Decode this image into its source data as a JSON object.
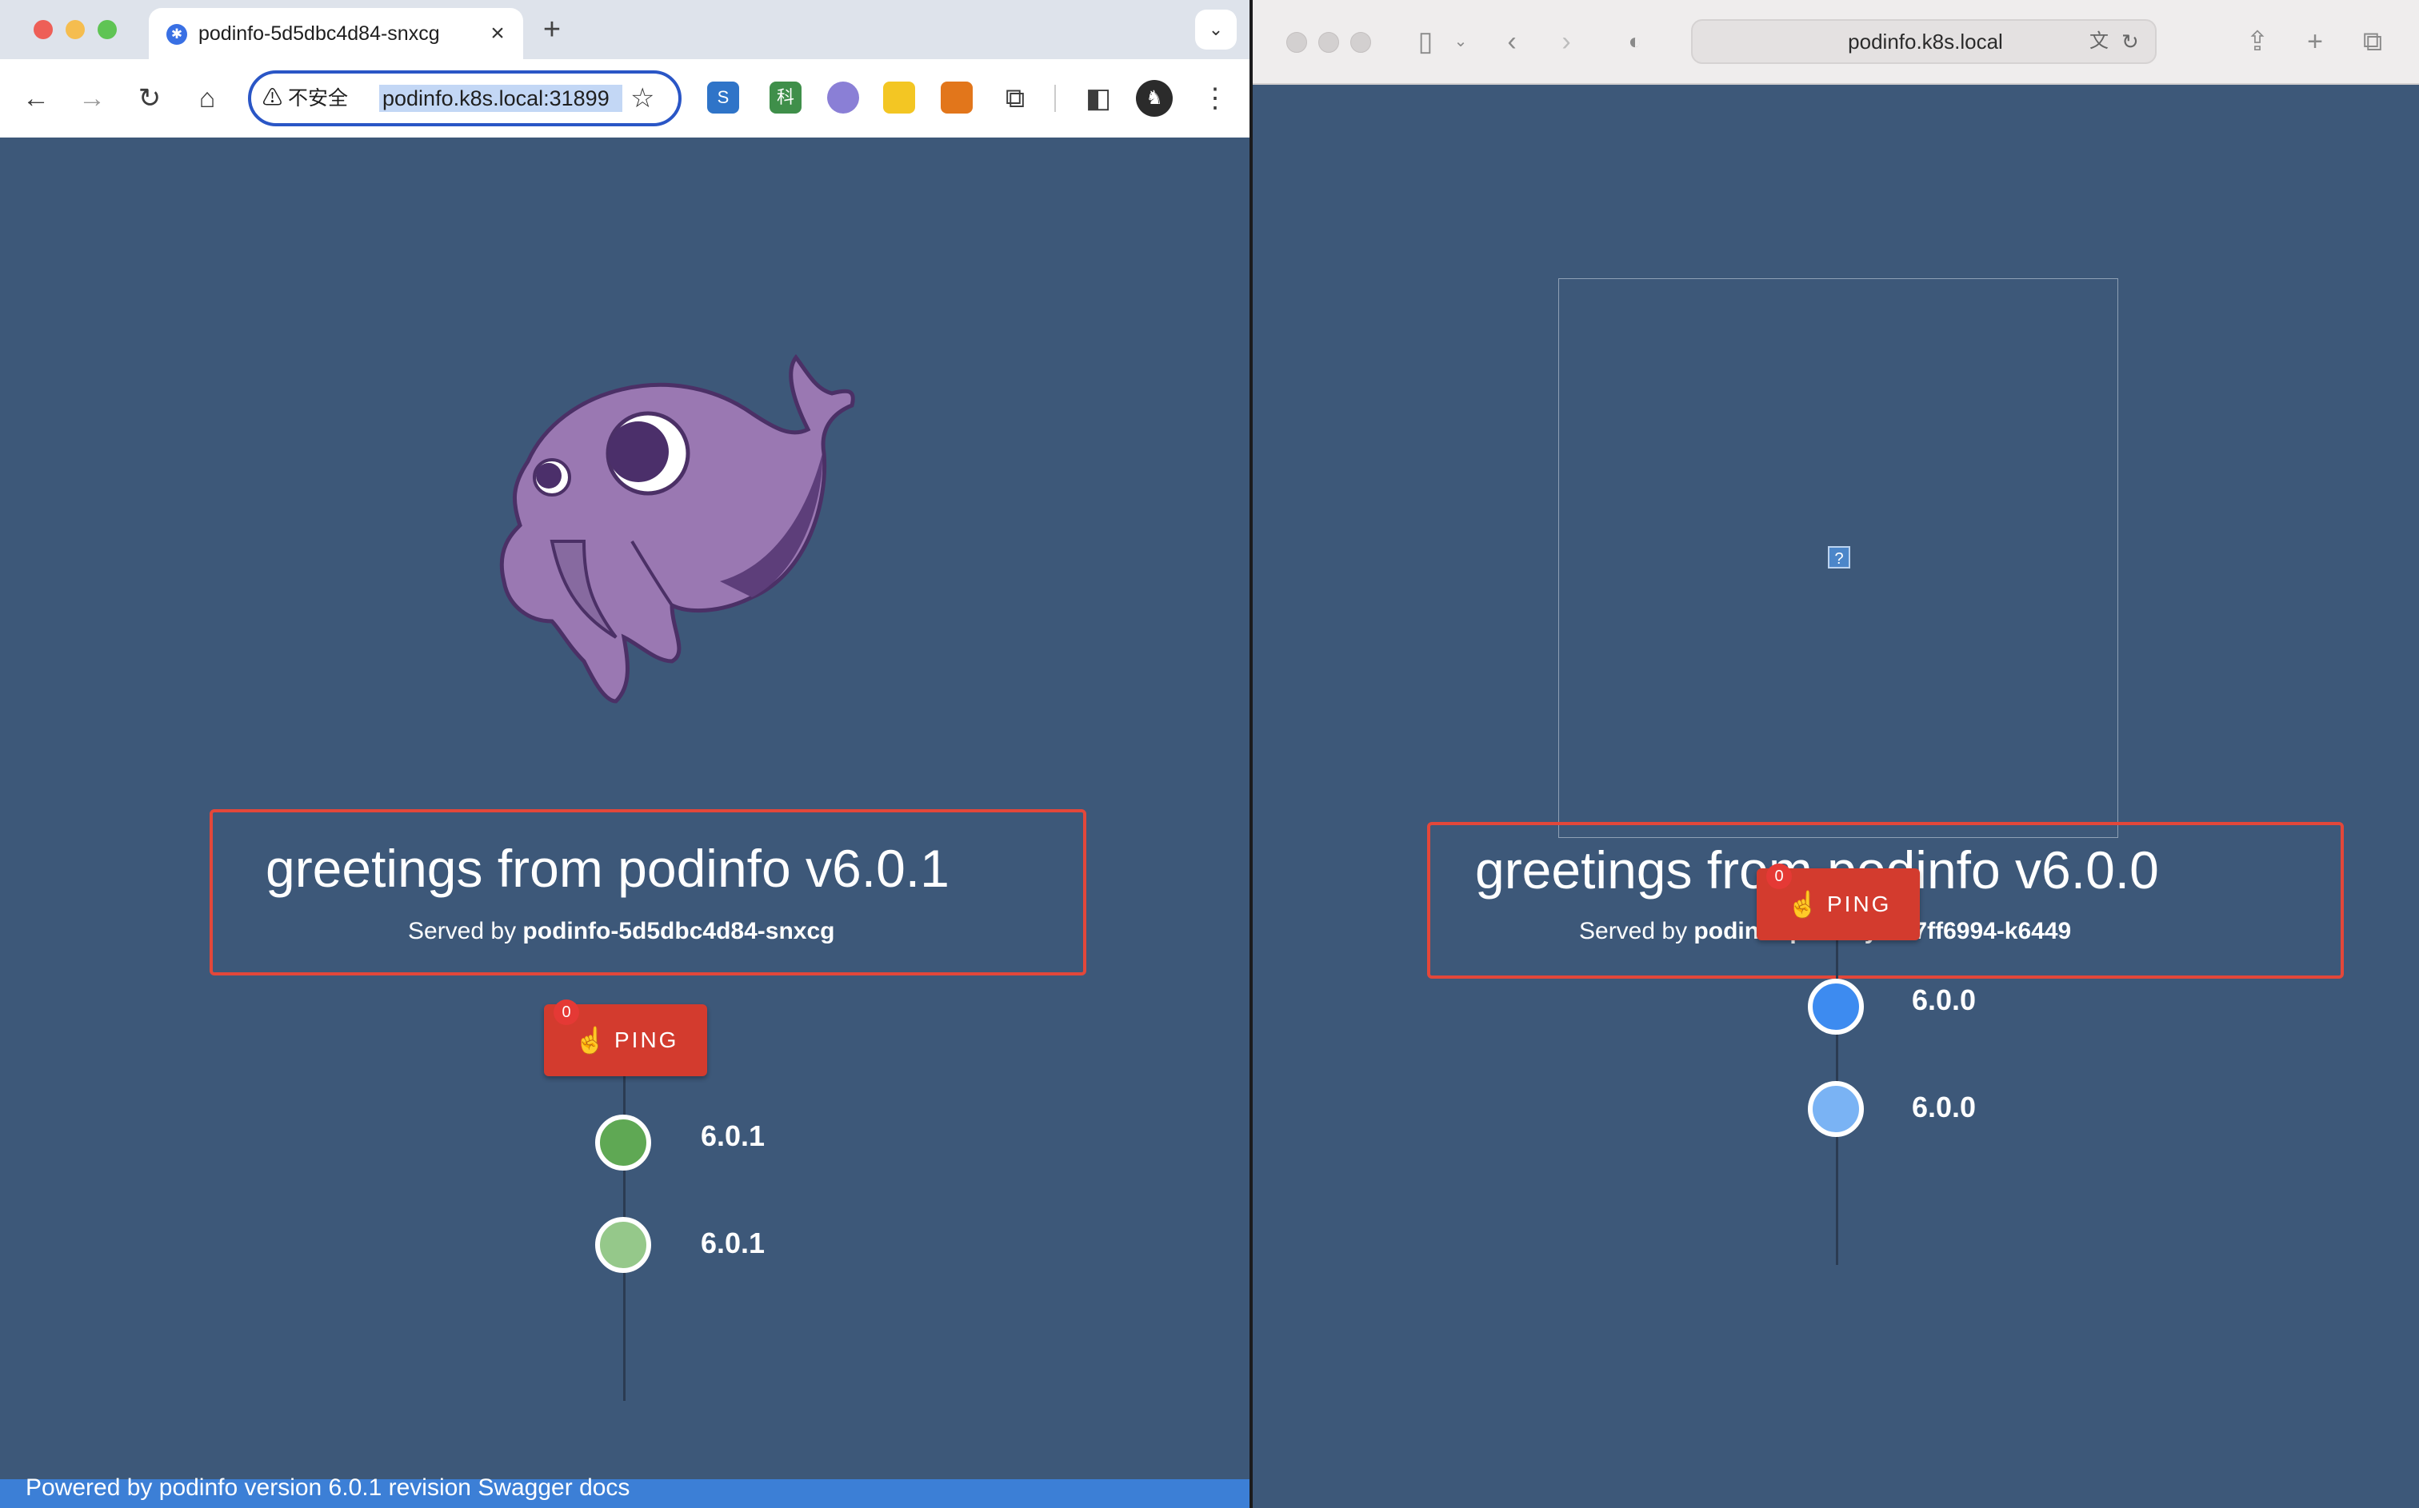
{
  "chrome": {
    "tab_title": "podinfo-5d5dbc4d84-snxcg",
    "security_label": "不安全",
    "url": "podinfo.k8s.local:31899",
    "greeting": "greetings from podinfo v6.0.1",
    "served_by_prefix": "Served by",
    "served_by_host": "podinfo-5d5dbc4d84-snxcg",
    "ping_label": "PING",
    "ping_count": "0",
    "versions": [
      "6.0.1",
      "6.0.1"
    ],
    "dot_colors": [
      "#5fa854",
      "#95c88a"
    ],
    "footer": "Powered by podinfo version 6.0.1 revision Swagger docs",
    "extensions": [
      "S",
      "科",
      "",
      "",
      "",
      ""
    ]
  },
  "safari": {
    "url": "podinfo.k8s.local",
    "broken_image_glyph": "?",
    "greeting": "greetings from podinfo v6.0.0",
    "served_by_prefix": "Served by",
    "served_by_host": "podinfo-primary-b67ff6994-k6449",
    "ping_label": "PING",
    "ping_count": "0",
    "versions": [
      "6.0.0",
      "6.0.0"
    ],
    "dot_colors": [
      "#3d8bf0",
      "#7ab3f4"
    ]
  },
  "colors": {
    "page_bg": "#3d5879",
    "highlight_border": "#e3473a",
    "ping_button": "#d33b2e",
    "mascot": "#9a78b2"
  },
  "icons": {
    "chrome_toolbar": [
      "back-arrow-icon",
      "forward-arrow-icon",
      "reload-icon",
      "home-icon",
      "warning-icon",
      "star-icon",
      "puzzle-icon",
      "sidepanel-icon",
      "profile-icon",
      "kebab-menu-icon"
    ],
    "safari_toolbar": [
      "sidebar-icon",
      "back-icon",
      "forward-icon",
      "shield-icon",
      "translate-icon",
      "reload-icon",
      "share-icon",
      "new-tab-icon",
      "tabs-overview-icon"
    ]
  }
}
